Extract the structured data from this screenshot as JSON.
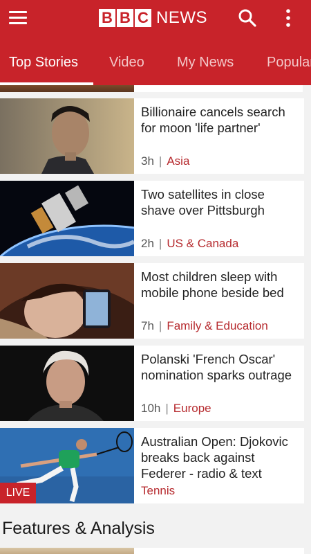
{
  "header": {
    "logo_letters": [
      "B",
      "B",
      "C"
    ],
    "logo_word": "NEWS",
    "icons": {
      "menu": "menu-icon",
      "search": "search-icon",
      "more": "more-vertical-icon"
    },
    "accent_color": "#c8232a"
  },
  "tabs": [
    {
      "label": "Top Stories",
      "active": true
    },
    {
      "label": "Video",
      "active": false
    },
    {
      "label": "My News",
      "active": false
    },
    {
      "label": "Popular",
      "active": false
    }
  ],
  "stories": [
    {
      "headline": "Billionaire cancels search for moon 'life partner'",
      "age": "3h",
      "topic": "Asia"
    },
    {
      "headline": "Two satellites in close shave over Pittsburgh",
      "age": "2h",
      "topic": "US & Canada"
    },
    {
      "headline": "Most children sleep with mobile phone beside bed",
      "age": "7h",
      "topic": "Family & Education"
    },
    {
      "headline": "Polanski 'French Oscar' nomination sparks outrage",
      "age": "10h",
      "topic": "Europe"
    },
    {
      "headline": "Australian Open: Djokovic breaks back against Federer - radio & text",
      "badge": "LIVE",
      "topic": "Tennis"
    }
  ],
  "sections": {
    "features_title": "Features & Analysis"
  }
}
